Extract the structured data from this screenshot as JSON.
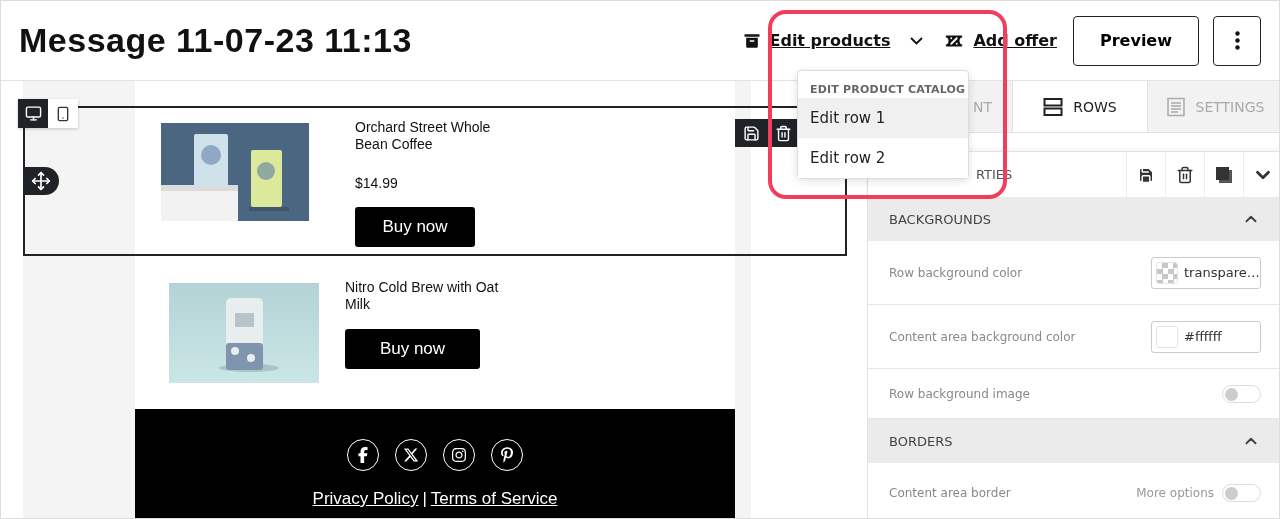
{
  "header": {
    "title": "Message 11-07-23 11:13",
    "edit_products": {
      "label": "Edit products",
      "expanded": true
    },
    "add_offer": "Add offer",
    "preview": "Preview"
  },
  "dropdown": {
    "heading": "EDIT PRODUCT CATALOG",
    "items": [
      {
        "label": "Edit row 1",
        "selected": true
      },
      {
        "label": "Edit row 2",
        "selected": false
      }
    ]
  },
  "device_toggle": [
    {
      "kind": "desktop",
      "selected": true
    },
    {
      "kind": "mobile",
      "selected": false
    }
  ],
  "products": [
    {
      "title": "Orchard Street Whole Bean Coffee",
      "price": "$14.99",
      "button": "Buy now",
      "selected": true,
      "kind": "bags"
    },
    {
      "title": "Nitro Cold Brew with Oat Milk",
      "button": "Buy now",
      "selected": false,
      "kind": "can"
    }
  ],
  "footer": {
    "links": [
      "Privacy Policy",
      "Terms of Service"
    ],
    "separator": "|"
  },
  "panel": {
    "tabs": [
      {
        "label": "NT",
        "selected": false
      },
      {
        "label": "ROWS",
        "selected": true
      },
      {
        "label": "SETTINGS",
        "selected": false
      }
    ],
    "properties_title": "RTIES",
    "sections": [
      {
        "title": "BACKGROUNDS",
        "expanded": true,
        "fields": [
          {
            "kind": "color",
            "label": "Row background color",
            "value": "transpare…",
            "transparent": true
          },
          {
            "kind": "color",
            "label": "Content area background color",
            "value": "#ffffff",
            "transparent": false
          },
          {
            "kind": "toggle",
            "label": "Row background image",
            "on": false
          }
        ]
      },
      {
        "title": "BORDERS",
        "expanded": true,
        "fields": [
          {
            "kind": "toggle",
            "label": "Content area border",
            "more_options": "More options",
            "on": false
          }
        ]
      }
    ]
  }
}
